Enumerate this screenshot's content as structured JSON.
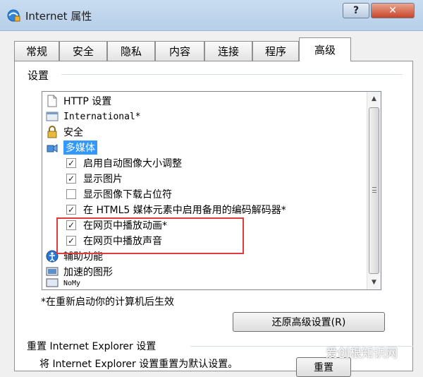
{
  "window": {
    "title": "Internet 属性",
    "help_label": "?",
    "close_label": "✕"
  },
  "tabs": [
    {
      "label": "常规"
    },
    {
      "label": "安全"
    },
    {
      "label": "隐私"
    },
    {
      "label": "内容"
    },
    {
      "label": "连接"
    },
    {
      "label": "程序"
    },
    {
      "label": "高级",
      "active": true
    }
  ],
  "settings": {
    "group_label": "设置",
    "tree": {
      "http": "HTTP 设置",
      "international": "International*",
      "security": "安全",
      "multimedia": "多媒体",
      "options": [
        {
          "label": "启用自动图像大小调整",
          "checked": true
        },
        {
          "label": "显示图片",
          "checked": true
        },
        {
          "label": "显示图像下载占位符",
          "checked": false
        },
        {
          "label": "在 HTML5 媒体元素中启用备用的编码解码器*",
          "checked": true
        },
        {
          "label": "在网页中播放动画*",
          "checked": true
        },
        {
          "label": "在网页中播放声音",
          "checked": true
        }
      ],
      "accessibility": "辅助功能",
      "accelerated": "加速的图形",
      "partial": "NoMy"
    },
    "footnote": "*在重新启动你的计算机后生效",
    "restore_button": "还原高级设置(R)"
  },
  "reset": {
    "label": "重置 Internet Explorer 设置",
    "description": "将 Internet Explorer 设置重置为默认设置。",
    "button": "重置"
  },
  "watermark": "爱创根知识网",
  "colors": {
    "selection": "#3399ff",
    "annotation": "#e23b3b",
    "close": "#c9452a"
  },
  "icons": {
    "window": "ie-settings-icon",
    "http": "document-icon",
    "international": "globe-page-icon",
    "security": "lock-icon",
    "multimedia": "multimedia-icon",
    "accessibility": "accessibility-icon",
    "accelerated": "graphics-icon"
  }
}
